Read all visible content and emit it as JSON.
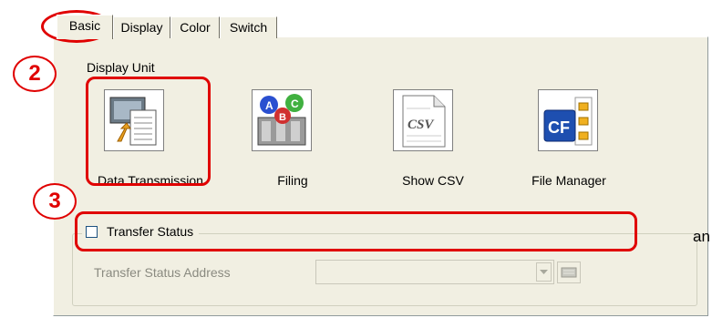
{
  "tabs": [
    {
      "label": "Basic",
      "active": true
    },
    {
      "label": "Display",
      "active": false
    },
    {
      "label": "Color",
      "active": false
    },
    {
      "label": "Switch",
      "active": false
    }
  ],
  "display_unit": {
    "label": "Display Unit",
    "buttons": [
      {
        "label": "Data Transmission",
        "icon": "data-transmission-icon"
      },
      {
        "label": "Filing",
        "icon": "filing-icon"
      },
      {
        "label": "Show CSV",
        "icon": "csv-icon",
        "icon_text": "CSV"
      },
      {
        "label": "File Manager",
        "icon": "file-manager-icon",
        "icon_text": "CF"
      }
    ]
  },
  "filing_icon_letters": [
    "A",
    "B",
    "C"
  ],
  "transfer_status": {
    "checkbox_label": "Transfer Status",
    "checked": false,
    "address_label": "Transfer Status Address",
    "address_value": ""
  },
  "callouts": {
    "step2": "2",
    "step3": "3"
  },
  "stray_text": "an",
  "colors": {
    "highlight": "#e00000",
    "panel": "#f1efe2"
  }
}
